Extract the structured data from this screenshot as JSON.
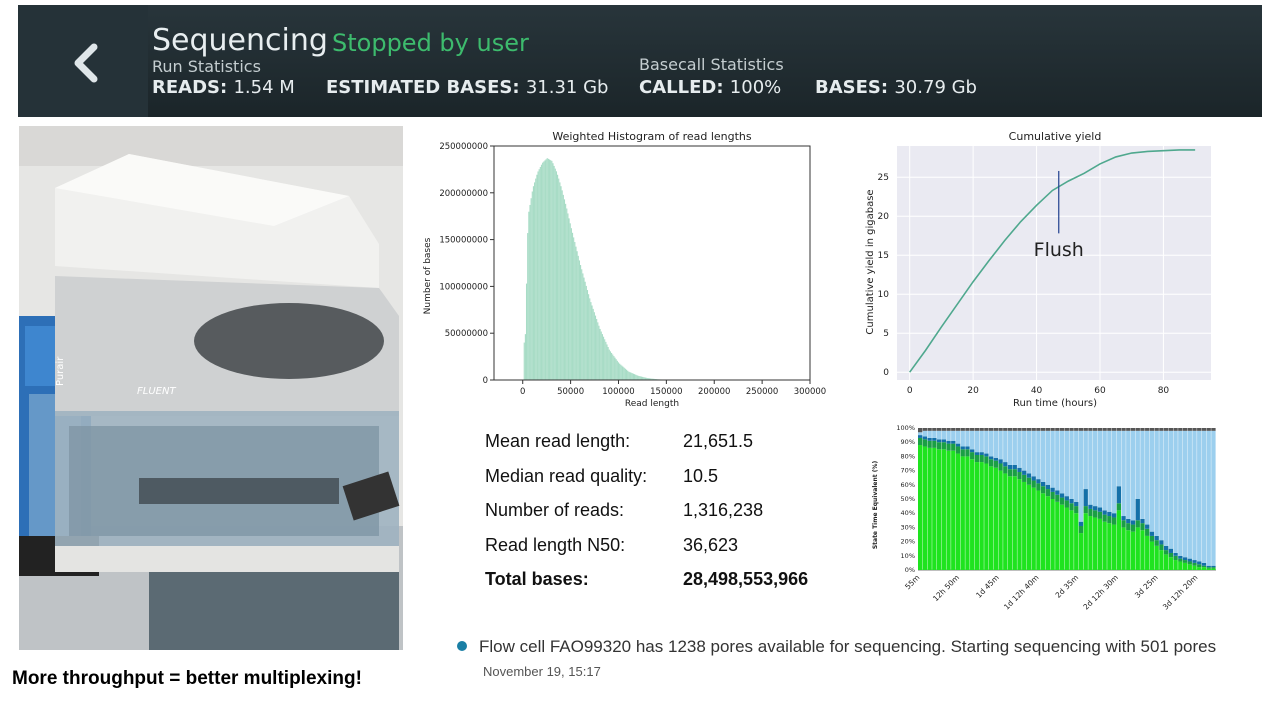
{
  "banner": {
    "title": "Sequencing",
    "status": "Stopped by user",
    "run_stats_label": "Run Statistics",
    "basecall_stats_label": "Basecall Statistics",
    "reads_label": "READS:",
    "reads_value": "1.54 M",
    "est_bases_label": "ESTIMATED BASES:",
    "est_bases_value": "31.31 Gb",
    "called_label": "CALLED:",
    "called_value": "100%",
    "bases_label": "BASES:",
    "bases_value": "30.79 Gb",
    "icons": {
      "back": "chevron-left-icon"
    }
  },
  "photo": {
    "instrument_label": "FLUENT",
    "side_label": "Purair"
  },
  "caption": "More throughput = better multiplexing!",
  "stats": [
    {
      "label": "Mean read length:",
      "value": "21,651.5"
    },
    {
      "label": "Median read quality:",
      "value": "10.5"
    },
    {
      "label": "Number of reads:",
      "value": "1,316,238"
    },
    {
      "label": "Read length N50:",
      "value": "36,623"
    },
    {
      "label": "Total bases:",
      "value": "28,498,553,966"
    }
  ],
  "notice": {
    "text": "Flow cell FAO99320 has 1238 pores available for sequencing. Starting sequencing with 501 pores",
    "timestamp": "November 19, 15:17",
    "dot_color": "#1a7fa5"
  },
  "chart_data": [
    {
      "type": "bar",
      "title": "Weighted Histogram of read lengths",
      "xlabel": "Read length",
      "ylabel": "Number of bases",
      "xlim": [
        -30000,
        300000
      ],
      "ylim": [
        0,
        250000000
      ],
      "xticks": [
        "0",
        "50000",
        "100000",
        "150000",
        "200000",
        "250000",
        "300000"
      ],
      "yticks": [
        "0",
        "50000000",
        "100000000",
        "150000000",
        "200000000",
        "250000000"
      ],
      "color": "#a8dcc6",
      "x": [
        2000,
        5000,
        10000,
        15000,
        20000,
        25000,
        30000,
        35000,
        40000,
        45000,
        50000,
        60000,
        70000,
        80000,
        90000,
        100000,
        110000,
        120000,
        130000,
        140000,
        150000
      ],
      "values": [
        40000000,
        175000000,
        205000000,
        222000000,
        232000000,
        237000000,
        234000000,
        222000000,
        205000000,
        185000000,
        163000000,
        122000000,
        85000000,
        55000000,
        32000000,
        18000000,
        9000000,
        4500000,
        2000000,
        800000,
        200000
      ]
    },
    {
      "type": "line",
      "title": "Cumulative yield",
      "xlabel": "Run time (hours)",
      "ylabel": "Cumulative yield in gigabase",
      "xlim": [
        -4,
        95
      ],
      "ylim": [
        -1,
        29
      ],
      "xticks": [
        "0",
        "20",
        "40",
        "60",
        "80"
      ],
      "yticks": [
        "0",
        "5",
        "10",
        "15",
        "20",
        "25"
      ],
      "annotation": {
        "text": "Flush",
        "x": 47
      },
      "color": "#4fa88e",
      "x": [
        0,
        5,
        10,
        15,
        20,
        25,
        30,
        35,
        40,
        45,
        50,
        55,
        60,
        65,
        70,
        75,
        80,
        85,
        90
      ],
      "values": [
        0,
        2.8,
        5.8,
        8.7,
        11.6,
        14.3,
        16.9,
        19.3,
        21.4,
        23.3,
        24.5,
        25.5,
        26.7,
        27.6,
        28.1,
        28.3,
        28.4,
        28.5,
        28.5
      ]
    },
    {
      "type": "bar",
      "stacked": true,
      "ylabel": "State Time Equivalent (%)",
      "yticks": [
        "0%",
        "10%",
        "20%",
        "30%",
        "40%",
        "50%",
        "60%",
        "70%",
        "80%",
        "90%",
        "100%"
      ],
      "xticks": [
        "55m",
        "12h 50m",
        "1d 45m",
        "1d 12h 40m",
        "2d 35m",
        "2d 12h 30m",
        "3d 25m",
        "3d 12h 20m"
      ],
      "colors": {
        "sequencing": "#1fe31f",
        "pore": "#1a9f44",
        "adapter": "#1470a8",
        "other": "#9ccfee",
        "unavailable": "#555555"
      },
      "sequencing": [
        88,
        87,
        86,
        86,
        85,
        85,
        84,
        84,
        82,
        80,
        80,
        78,
        76,
        76,
        75,
        73,
        72,
        70,
        68,
        66,
        66,
        64,
        62,
        60,
        58,
        56,
        54,
        52,
        50,
        48,
        46,
        44,
        42,
        40,
        26,
        40,
        38,
        37,
        36,
        34,
        33,
        32,
        42,
        30,
        28,
        27,
        30,
        28,
        24,
        20,
        17,
        14,
        11,
        9,
        7,
        6,
        5,
        4,
        3,
        2,
        2,
        1,
        1
      ],
      "pore": [
        5,
        5,
        5,
        5,
        5,
        5,
        5,
        5,
        5,
        5,
        5,
        5,
        5,
        5,
        5,
        5,
        5,
        5,
        5,
        5,
        5,
        5,
        5,
        5,
        5,
        5,
        5,
        5,
        5,
        5,
        5,
        5,
        5,
        5,
        5,
        5,
        5,
        5,
        5,
        5,
        5,
        5,
        5,
        5,
        5,
        5,
        5,
        5,
        5,
        4,
        4,
        4,
        3,
        3,
        3,
        2,
        2,
        2,
        2,
        2,
        1,
        1,
        1
      ],
      "adapter": [
        2,
        2,
        2,
        2,
        2,
        2,
        2,
        2,
        2,
        2,
        2,
        2,
        2,
        2,
        2,
        2,
        2,
        3,
        3,
        3,
        3,
        3,
        3,
        3,
        3,
        3,
        3,
        3,
        3,
        3,
        3,
        3,
        3,
        3,
        3,
        12,
        3,
        3,
        3,
        3,
        3,
        3,
        12,
        3,
        3,
        3,
        15,
        3,
        3,
        3,
        3,
        3,
        3,
        3,
        2,
        2,
        2,
        2,
        2,
        2,
        2,
        1,
        1
      ],
      "unavailable": [
        3,
        2,
        2,
        2,
        2,
        2,
        2,
        2,
        2,
        2,
        2,
        2,
        2,
        2,
        2,
        2,
        2,
        2,
        2,
        2,
        2,
        2,
        2,
        2,
        2,
        2,
        2,
        2,
        2,
        2,
        2,
        2,
        2,
        2,
        2,
        2,
        2,
        2,
        2,
        2,
        2,
        2,
        2,
        2,
        2,
        2,
        2,
        2,
        2,
        2,
        2,
        2,
        2,
        2,
        2,
        2,
        2,
        2,
        2,
        2,
        2,
        2,
        2
      ]
    }
  ]
}
